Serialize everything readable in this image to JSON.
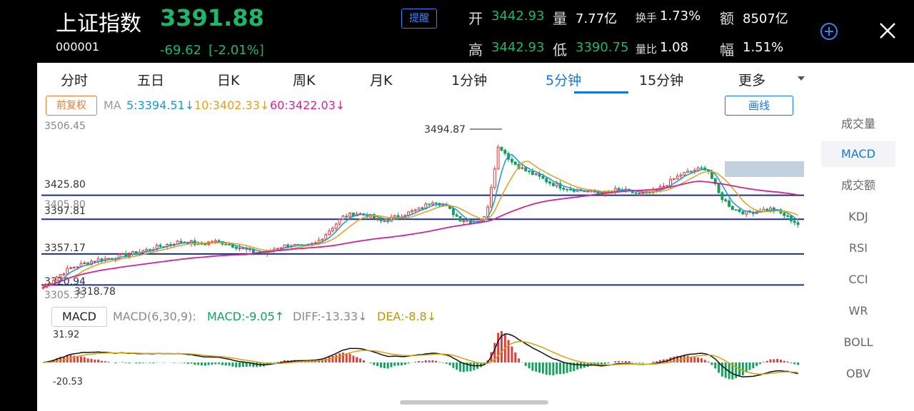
{
  "header": {
    "name": "上证指数",
    "code": "000001",
    "price": "3391.88",
    "change": "-69.62",
    "change_pct": "[-2.01%]",
    "alert_button": "提醒",
    "stats": {
      "open_label": "开",
      "open_value": "3442.93",
      "volume_label": "量",
      "volume_value": "7.77亿",
      "turnover_label": "换手",
      "turnover_value": "1.73%",
      "amount_label": "额",
      "amount_value": "8507亿",
      "high_label": "高",
      "high_value": "3442.93",
      "low_label": "低",
      "low_value": "3390.75",
      "ratio_label": "量比",
      "ratio_value": "1.08",
      "amplitude_label": "幅",
      "amplitude_value": "1.51%"
    }
  },
  "tabs": [
    "分时",
    "五日",
    "日K",
    "周K",
    "月K",
    "1分钟",
    "5分钟",
    "15分钟",
    "更多"
  ],
  "active_tab": "5分钟",
  "ma_bar": {
    "adjust_button": "前复权",
    "ma_label": "MA",
    "ma5": "5:3394.51↓",
    "ma10": "10:3402.33↓",
    "ma60": "60:3422.03↓",
    "draw_button": "画线"
  },
  "price_labels": {
    "top": "3506.45",
    "peak": "3494.87",
    "line1": "3425.80",
    "ghost": "3405.80",
    "line2": "3397.81",
    "line3": "3357.17",
    "line4": "3320.94",
    "low": "3318.78",
    "bottom": "3305.35"
  },
  "macd_bar": {
    "button": "MACD",
    "params": "MACD(6,30,9):",
    "macd": "MACD:-9.05↑",
    "diff": "DIFF:-13.33↓",
    "dea": "DEA:-8.8↓",
    "axis_top": "31.92",
    "axis_bottom": "-20.53"
  },
  "side_menu": [
    "成交量",
    "MACD",
    "成交额",
    "KDJ",
    "RSI",
    "CCI",
    "WR",
    "BOLL",
    "OBV"
  ],
  "active_side": "MACD",
  "colors": {
    "up": "#e03a3a",
    "down": "#14a05c",
    "ma5": "#1e96d2",
    "ma10": "#e0a020",
    "ma60": "#c8289a",
    "accent": "#1976d2"
  },
  "chart_data": {
    "type": "candlestick",
    "price_range": [
      3305.35,
      3506.45
    ],
    "horizontal_lines": [
      3425.8,
      3397.81,
      3357.17,
      3320.94
    ],
    "close_path": [
      3318,
      3330,
      3340,
      3345,
      3350,
      3352,
      3355,
      3358,
      3362,
      3366,
      3370,
      3372,
      3368,
      3372,
      3370,
      3365,
      3360,
      3358,
      3365,
      3368,
      3365,
      3370,
      3385,
      3400,
      3405,
      3402,
      3395,
      3400,
      3405,
      3410,
      3420,
      3412,
      3398,
      3395,
      3400,
      3485,
      3465,
      3455,
      3448,
      3440,
      3435,
      3432,
      3430,
      3428,
      3432,
      3430,
      3427,
      3430,
      3440,
      3450,
      3455,
      3458,
      3425,
      3410,
      3405,
      3408,
      3410,
      3402,
      3392
    ]
  }
}
